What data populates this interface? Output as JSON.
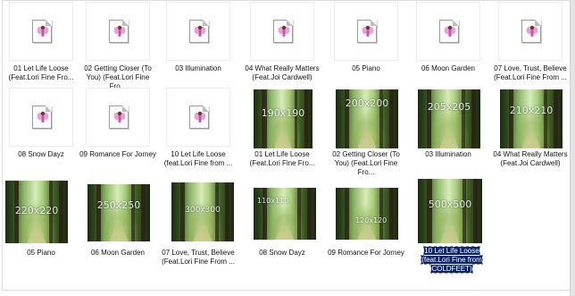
{
  "files": [
    {
      "label": "01 Let Life Loose (Feat.Lori Fine Fro...",
      "thumb": "generic"
    },
    {
      "label": "02 Getting Closer (To You) (Feat.Lori Fine Fro...",
      "thumb": "generic"
    },
    {
      "label": "03 Illumination",
      "thumb": "generic"
    },
    {
      "label": "04 What Really Matters (Feat.Joi Cardwell)",
      "thumb": "generic"
    },
    {
      "label": "05 Piano",
      "thumb": "generic"
    },
    {
      "label": "06 Moon Garden",
      "thumb": "generic"
    },
    {
      "label": "07 Love, Trust, Believe (Feat.Lori Fine From ...",
      "thumb": "generic"
    },
    {
      "label": "08 Snow Dayz",
      "thumb": "generic"
    },
    {
      "label": "09 Romance For Jorney",
      "thumb": "generic"
    },
    {
      "label": "10 Let Life Loose (feat.Lori Fine from ...",
      "thumb": "generic"
    },
    {
      "label": "01 Let Life Loose (Feat.Lori Fine Fro...",
      "thumb": "photo",
      "size": "190x190"
    },
    {
      "label": "02 Getting Closer (To You) (Feat.Lori Fine Fro...",
      "thumb": "photo",
      "size": "200x200"
    },
    {
      "label": "03 Illumination",
      "thumb": "photo",
      "size": "205x205"
    },
    {
      "label": "04 What Really Matters (Feat.Joi Cardwell)",
      "thumb": "photo",
      "size": "210x210"
    },
    {
      "label": "05 Piano",
      "thumb": "photo",
      "size": "220x220"
    },
    {
      "label": "06 Moon Garden",
      "thumb": "photo",
      "size": "250x250"
    },
    {
      "label": "07 Love, Trust, Believe (Feat.Lori Fine From ...",
      "thumb": "photo",
      "size": "300x300"
    },
    {
      "label": "08 Snow Dayz",
      "thumb": "photo",
      "size": "110x110"
    },
    {
      "label": "09 Romance For Jorney",
      "thumb": "photo",
      "size": "120x120"
    },
    {
      "label": "10 Let Life Loose (feat.Lori Fine from COLDFEET)",
      "thumb": "photo",
      "size": "500x500",
      "selected": true
    }
  ],
  "colors": {
    "selection": "#0a246a",
    "forest_light": "#d7ecb8",
    "forest_dark": "#1d2a12"
  }
}
